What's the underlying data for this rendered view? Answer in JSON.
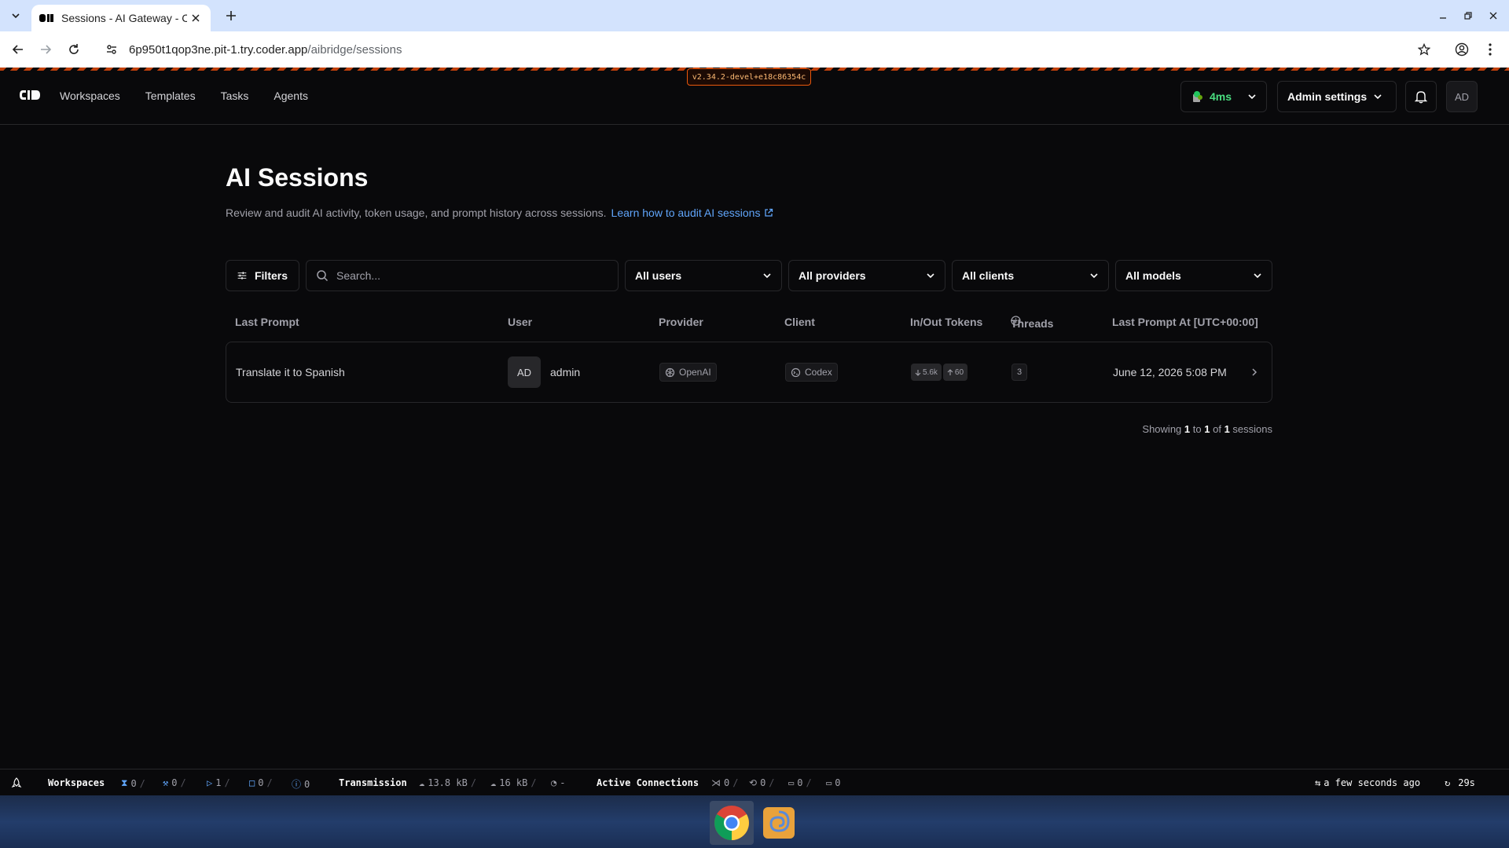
{
  "browser": {
    "tab_title": "Sessions - AI Gateway - C",
    "url_host": "6p950t1qop3ne.pit-1.try.coder.app",
    "url_path": "/aibridge/sessions"
  },
  "version_badge": "v2.34.2-devel+e18c86354c",
  "navbar": {
    "links": [
      "Workspaces",
      "Templates",
      "Tasks",
      "Agents"
    ],
    "latency": "4ms",
    "admin_settings": "Admin settings",
    "avatar": "AD"
  },
  "page": {
    "title": "AI Sessions",
    "description": "Review and audit AI activity, token usage, and prompt history across sessions.",
    "learn_link": "Learn how to audit AI sessions"
  },
  "filters": {
    "filters_label": "Filters",
    "search_placeholder": "Search...",
    "users": "All users",
    "providers": "All providers",
    "clients": "All clients",
    "models": "All models"
  },
  "table": {
    "headers": {
      "last_prompt": "Last Prompt",
      "user": "User",
      "provider": "Provider",
      "client": "Client",
      "tokens": "In/Out Tokens",
      "threads": "Threads",
      "last_prompt_at": "Last Prompt At [UTC+00:00]"
    },
    "rows": [
      {
        "prompt": "Translate it to Spanish",
        "user_initials": "AD",
        "user_name": "admin",
        "provider": "OpenAI",
        "client": "Codex",
        "tokens_in": "5.6k",
        "tokens_out": "60",
        "threads": "3",
        "date": "June 12, 2026 5:08 PM"
      }
    ]
  },
  "pagination": {
    "prefix": "Showing",
    "from": "1",
    "to_word": "to",
    "to": "1",
    "of_word": "of",
    "total": "1",
    "suffix": "sessions"
  },
  "statusbar": {
    "workspaces_label": "Workspaces",
    "pending": "0",
    "building": "0",
    "running": "1",
    "stopped": "0",
    "errored": "0",
    "transmission_label": "Transmission",
    "rx": "13.8 kB",
    "tx": "16 kB",
    "latency": "-",
    "connections_label": "Active Connections",
    "vscode": "0",
    "ssh": "0",
    "terminal": "0",
    "apps": "0",
    "updated": "a few seconds ago",
    "refresh": "29s"
  },
  "colors": {
    "background": "#09090b",
    "border": "#27272a",
    "link": "#60a5fa",
    "latency_green": "#4ade80",
    "version_orange": "#ea580c"
  }
}
